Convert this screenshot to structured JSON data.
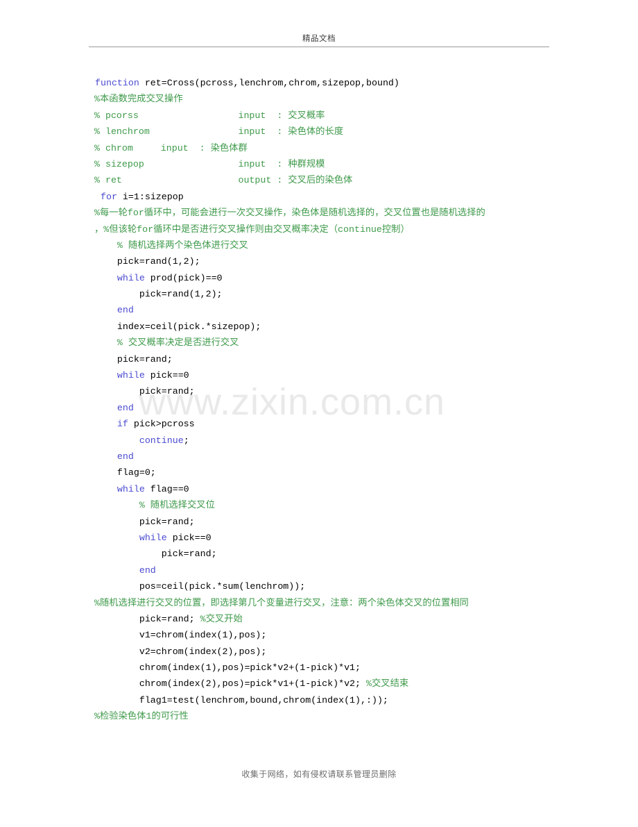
{
  "header": {
    "title": "精品文档"
  },
  "watermark": {
    "text": "www.zixin.com.cn"
  },
  "footer": {
    "text": "收集于网络，如有侵权请联系管理员删除"
  },
  "colors": {
    "keyword": "#4a4ad0",
    "comment": "#3f9a4b",
    "text": "#000000",
    "watermark": "#e9e9e9",
    "header_rule": "#9a9a9a",
    "footer_text": "#6e6e6e",
    "page_background": "#ffffff"
  },
  "code": {
    "language": "MATLAB",
    "lines": [
      {
        "indent": 0,
        "segments": [
          {
            "kind": "keyword",
            "text": "function"
          },
          {
            "kind": "text",
            "text": " ret=Cross(pcross,lenchrom,chrom,sizepop,bound)"
          }
        ]
      },
      {
        "indent": 0,
        "flush": true,
        "segments": [
          {
            "kind": "comment",
            "text": "%本函数完成交叉操作"
          }
        ]
      },
      {
        "indent": 0,
        "flush": true,
        "segments": [
          {
            "kind": "comment",
            "text": "% pcorss                  input  : 交叉概率"
          }
        ]
      },
      {
        "indent": 0,
        "flush": true,
        "segments": [
          {
            "kind": "comment",
            "text": "% lenchrom                input  : 染色体的长度"
          }
        ]
      },
      {
        "indent": 0,
        "flush": true,
        "segments": [
          {
            "kind": "comment",
            "text": "% chrom     input  : 染色体群"
          }
        ]
      },
      {
        "indent": 0,
        "flush": true,
        "segments": [
          {
            "kind": "comment",
            "text": "% sizepop                 input  : 种群规模"
          }
        ]
      },
      {
        "indent": 0,
        "flush": true,
        "segments": [
          {
            "kind": "comment",
            "text": "% ret                     output : 交叉后的染色体"
          }
        ]
      },
      {
        "indent": 0,
        "segments": [
          {
            "kind": "text",
            "text": " "
          },
          {
            "kind": "keyword",
            "text": "for"
          },
          {
            "kind": "text",
            "text": " i=1:sizepop"
          }
        ]
      },
      {
        "indent": 0,
        "flush": true,
        "segments": [
          {
            "kind": "comment",
            "text": "%每一轮for循环中，可能会进行一次交叉操作，染色体是随机选择的，交叉位置也是随机选择的"
          }
        ]
      },
      {
        "indent": 0,
        "flush": true,
        "segments": [
          {
            "kind": "comment",
            "text": "，%但该轮for循环中是否进行交叉操作则由交叉概率决定（continue控制）"
          }
        ]
      },
      {
        "indent": 1,
        "segments": [
          {
            "kind": "comment",
            "text": "    % 随机选择两个染色体进行交叉"
          }
        ]
      },
      {
        "indent": 1,
        "segments": [
          {
            "kind": "text",
            "text": "    pick=rand(1,2);"
          }
        ]
      },
      {
        "indent": 1,
        "segments": [
          {
            "kind": "text",
            "text": "    "
          },
          {
            "kind": "keyword",
            "text": "while"
          },
          {
            "kind": "text",
            "text": " prod(pick)==0"
          }
        ]
      },
      {
        "indent": 2,
        "segments": [
          {
            "kind": "text",
            "text": "        pick=rand(1,2);"
          }
        ]
      },
      {
        "indent": 1,
        "segments": [
          {
            "kind": "text",
            "text": "    "
          },
          {
            "kind": "keyword",
            "text": "end"
          }
        ]
      },
      {
        "indent": 1,
        "segments": [
          {
            "kind": "text",
            "text": "    index=ceil(pick.*sizepop);"
          }
        ]
      },
      {
        "indent": 1,
        "segments": [
          {
            "kind": "comment",
            "text": "    % 交叉概率决定是否进行交叉"
          }
        ]
      },
      {
        "indent": 1,
        "segments": [
          {
            "kind": "text",
            "text": "    pick=rand;"
          }
        ]
      },
      {
        "indent": 1,
        "segments": [
          {
            "kind": "text",
            "text": "    "
          },
          {
            "kind": "keyword",
            "text": "while"
          },
          {
            "kind": "text",
            "text": " pick==0"
          }
        ]
      },
      {
        "indent": 2,
        "segments": [
          {
            "kind": "text",
            "text": "        pick=rand;"
          }
        ]
      },
      {
        "indent": 1,
        "segments": [
          {
            "kind": "text",
            "text": "    "
          },
          {
            "kind": "keyword",
            "text": "end"
          }
        ]
      },
      {
        "indent": 1,
        "segments": [
          {
            "kind": "text",
            "text": "    "
          },
          {
            "kind": "keyword",
            "text": "if"
          },
          {
            "kind": "text",
            "text": " pick>pcross"
          }
        ]
      },
      {
        "indent": 2,
        "segments": [
          {
            "kind": "text",
            "text": "        "
          },
          {
            "kind": "keyword",
            "text": "continue"
          },
          {
            "kind": "text",
            "text": ";"
          }
        ]
      },
      {
        "indent": 1,
        "segments": [
          {
            "kind": "text",
            "text": "    "
          },
          {
            "kind": "keyword",
            "text": "end"
          }
        ]
      },
      {
        "indent": 1,
        "segments": [
          {
            "kind": "text",
            "text": "    flag=0;"
          }
        ]
      },
      {
        "indent": 1,
        "segments": [
          {
            "kind": "text",
            "text": "    "
          },
          {
            "kind": "keyword",
            "text": "while"
          },
          {
            "kind": "text",
            "text": " flag==0"
          }
        ]
      },
      {
        "indent": 2,
        "segments": [
          {
            "kind": "comment",
            "text": "        % 随机选择交叉位"
          }
        ]
      },
      {
        "indent": 2,
        "segments": [
          {
            "kind": "text",
            "text": "        pick=rand;"
          }
        ]
      },
      {
        "indent": 2,
        "segments": [
          {
            "kind": "text",
            "text": "        "
          },
          {
            "kind": "keyword",
            "text": "while"
          },
          {
            "kind": "text",
            "text": " pick==0"
          }
        ]
      },
      {
        "indent": 3,
        "segments": [
          {
            "kind": "text",
            "text": "            pick=rand;"
          }
        ]
      },
      {
        "indent": 2,
        "segments": [
          {
            "kind": "text",
            "text": "        "
          },
          {
            "kind": "keyword",
            "text": "end"
          }
        ]
      },
      {
        "indent": 2,
        "segments": [
          {
            "kind": "text",
            "text": "        pos=ceil(pick.*sum(lenchrom));"
          }
        ]
      },
      {
        "indent": 0,
        "flush": true,
        "segments": [
          {
            "kind": "comment",
            "text": "%随机选择进行交叉的位置，即选择第几个变量进行交叉，注意：两个染色体交叉的位置相同"
          }
        ]
      },
      {
        "indent": 2,
        "segments": [
          {
            "kind": "text",
            "text": "        pick=rand; "
          },
          {
            "kind": "comment",
            "text": "%交叉开始"
          }
        ]
      },
      {
        "indent": 2,
        "segments": [
          {
            "kind": "text",
            "text": "        v1=chrom(index(1),pos);"
          }
        ]
      },
      {
        "indent": 2,
        "segments": [
          {
            "kind": "text",
            "text": "        v2=chrom(index(2),pos);"
          }
        ]
      },
      {
        "indent": 2,
        "segments": [
          {
            "kind": "text",
            "text": "        chrom(index(1),pos)=pick*v2+(1-pick)*v1;"
          }
        ]
      },
      {
        "indent": 2,
        "segments": [
          {
            "kind": "text",
            "text": "        chrom(index(2),pos)=pick*v1+(1-pick)*v2; "
          },
          {
            "kind": "comment",
            "text": "%交叉结束"
          }
        ]
      },
      {
        "indent": 2,
        "segments": [
          {
            "kind": "text",
            "text": "        flag1=test(lenchrom,bound,chrom(index(1),:));"
          }
        ]
      },
      {
        "indent": 0,
        "flush": true,
        "segments": [
          {
            "kind": "comment",
            "text": "%检验染色体1的可行性"
          }
        ]
      }
    ]
  }
}
